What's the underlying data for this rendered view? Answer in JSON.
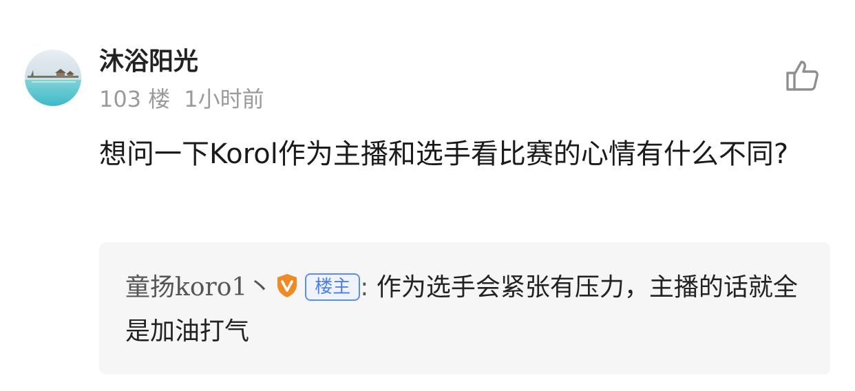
{
  "comment": {
    "avatar_icon": "beach-resort-avatar",
    "username": "沐浴阳光",
    "floor": "103 楼",
    "time": "1小时前",
    "like_icon": "thumbs-up-icon",
    "content": "想问一下Korol作为主播和选手看比赛的心情有什么不同?"
  },
  "reply": {
    "author": "童扬koro1丶",
    "badge_icon": "vip-shield-icon",
    "host_tag": "楼主",
    "separator": ":",
    "text": " 作为选手会紧张有压力，主播的话就全是加油打气"
  },
  "colors": {
    "background": "#ffffff",
    "reply_background": "#f6f6f6",
    "meta_text": "#9a9a9a",
    "host_tag": "#4a7fe8",
    "vip_badge": "#f08a24"
  }
}
